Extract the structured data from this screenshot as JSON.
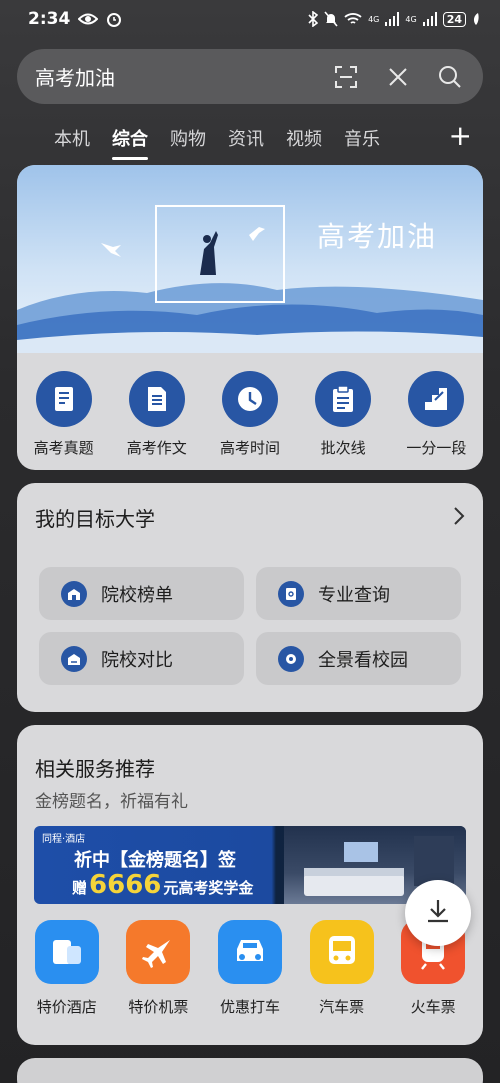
{
  "status": {
    "time": "2:34",
    "battery": "24",
    "net1": "4G",
    "net2": "4G"
  },
  "search": {
    "text": "高考加油"
  },
  "tabs": [
    {
      "label": "本机",
      "active": false
    },
    {
      "label": "综合",
      "active": true
    },
    {
      "label": "购物",
      "active": false
    },
    {
      "label": "资讯",
      "active": false
    },
    {
      "label": "视频",
      "active": false
    },
    {
      "label": "音乐",
      "active": false
    }
  ],
  "banner": {
    "title": "高考加油"
  },
  "shortcuts": [
    {
      "label": "高考真题",
      "icon": "book-icon"
    },
    {
      "label": "高考作文",
      "icon": "document-icon"
    },
    {
      "label": "高考时间",
      "icon": "clock-icon"
    },
    {
      "label": "批次线",
      "icon": "clipboard-icon"
    },
    {
      "label": "一分一段",
      "icon": "stairs-icon"
    }
  ],
  "target": {
    "title": "我的目标大学",
    "items": [
      {
        "label": "院校榜单",
        "icon": "school-rank-icon"
      },
      {
        "label": "专业查询",
        "icon": "major-search-icon"
      },
      {
        "label": "院校对比",
        "icon": "compare-icon"
      },
      {
        "label": "全景看校园",
        "icon": "panorama-icon"
      }
    ]
  },
  "services": {
    "title": "相关服务推荐",
    "subtitle": "金榜题名，祈福有礼",
    "ad": {
      "brand": "同程·酒店",
      "line1": "祈中【金榜题名】签",
      "line2_pre": "赠",
      "line2_num": "6666",
      "line2_post": "元高考奖学金"
    },
    "items": [
      {
        "label": "特价酒店",
        "icon": "hotel-icon",
        "color": "#2a8ff0"
      },
      {
        "label": "特价机票",
        "icon": "plane-icon",
        "color": "#f5792b"
      },
      {
        "label": "优惠打车",
        "icon": "car-icon",
        "color": "#2a8ff0"
      },
      {
        "label": "汽车票",
        "icon": "bus-icon",
        "color": "#f6c21c"
      },
      {
        "label": "火车票",
        "icon": "train-icon",
        "color": "#f0522e"
      }
    ]
  },
  "colors": {
    "accent": "#2856a4",
    "card": "#d9d9db"
  }
}
